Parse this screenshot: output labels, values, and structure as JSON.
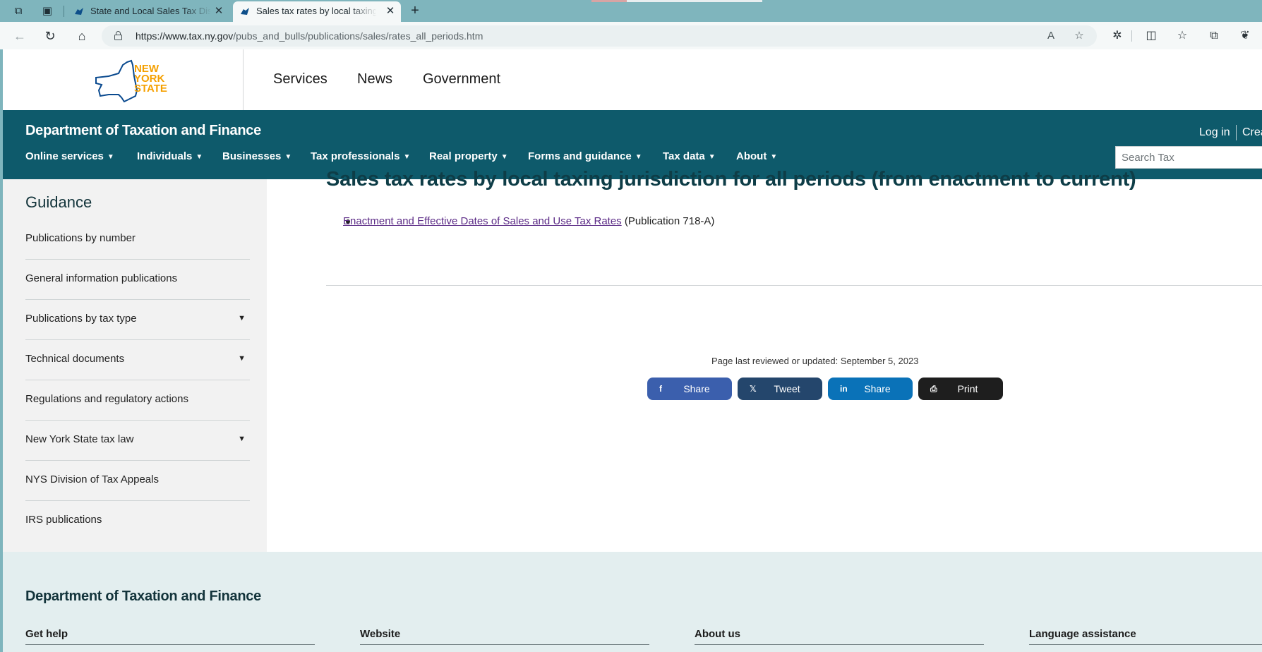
{
  "browser": {
    "tabs": [
      {
        "title": "State and Local Sales Tax Distribu",
        "active": false
      },
      {
        "title": "Sales tax rates by local taxing juri",
        "active": true
      }
    ],
    "url_domain": "https://www.tax.ny.gov",
    "url_path": "/pubs_and_bulls/publications/sales/rates_all_periods.htm",
    "icons": [
      "collections-icon",
      "tab-actions-icon",
      "back-icon",
      "refresh-icon",
      "home-icon",
      "read-aloud-icon",
      "favorite-star-icon",
      "extensions-icon",
      "split-screen-icon",
      "favorites-icon",
      "collections-icon",
      "copilot-icon"
    ]
  },
  "gov_header": {
    "logo_lines": [
      "NEW",
      "YORK",
      "STATE"
    ],
    "links": [
      "Services",
      "News",
      "Government"
    ]
  },
  "dept": {
    "title": "Department of Taxation and Finance",
    "login": "Log in",
    "create": "Create account",
    "search_placeholder": "Search Tax",
    "nav": [
      "Online services",
      "Individuals",
      "Businesses",
      "Tax professionals",
      "Real property",
      "Forms and guidance",
      "Tax data",
      "About"
    ]
  },
  "sidebar": {
    "heading": "Guidance",
    "items": [
      {
        "label": "Publications by number",
        "expandable": false
      },
      {
        "label": "General information publications",
        "expandable": false
      },
      {
        "label": "Publications by tax type",
        "expandable": true
      },
      {
        "label": "Technical documents",
        "expandable": true
      },
      {
        "label": "Regulations and regulatory actions",
        "expandable": false
      },
      {
        "label": "New York State tax law",
        "expandable": true
      },
      {
        "label": "NYS Division of Tax Appeals",
        "expandable": false
      },
      {
        "label": "IRS publications",
        "expandable": false
      }
    ]
  },
  "main": {
    "heading": "Sales tax rates by local taxing jurisdiction for all periods (from enactment to current)",
    "link_text": "Enactment and Effective Dates of Sales and Use Tax Rates",
    "link_suffix": " (Publication 718-A)",
    "reviewed": "Page last reviewed or updated: September 5, 2023",
    "share": [
      {
        "label": "Share",
        "icon": "f",
        "color": "#3b5fad"
      },
      {
        "label": "Tweet",
        "icon": "𝕏",
        "color": "#24466c"
      },
      {
        "label": "Share",
        "icon": "in",
        "color": "#0a72b8"
      },
      {
        "label": "Print",
        "icon": "⎙",
        "color": "#1e1e1e"
      }
    ]
  },
  "footer": {
    "title": "Department of Taxation and Finance",
    "columns": [
      "Get help",
      "Website",
      "About us",
      "Language assistance"
    ]
  }
}
